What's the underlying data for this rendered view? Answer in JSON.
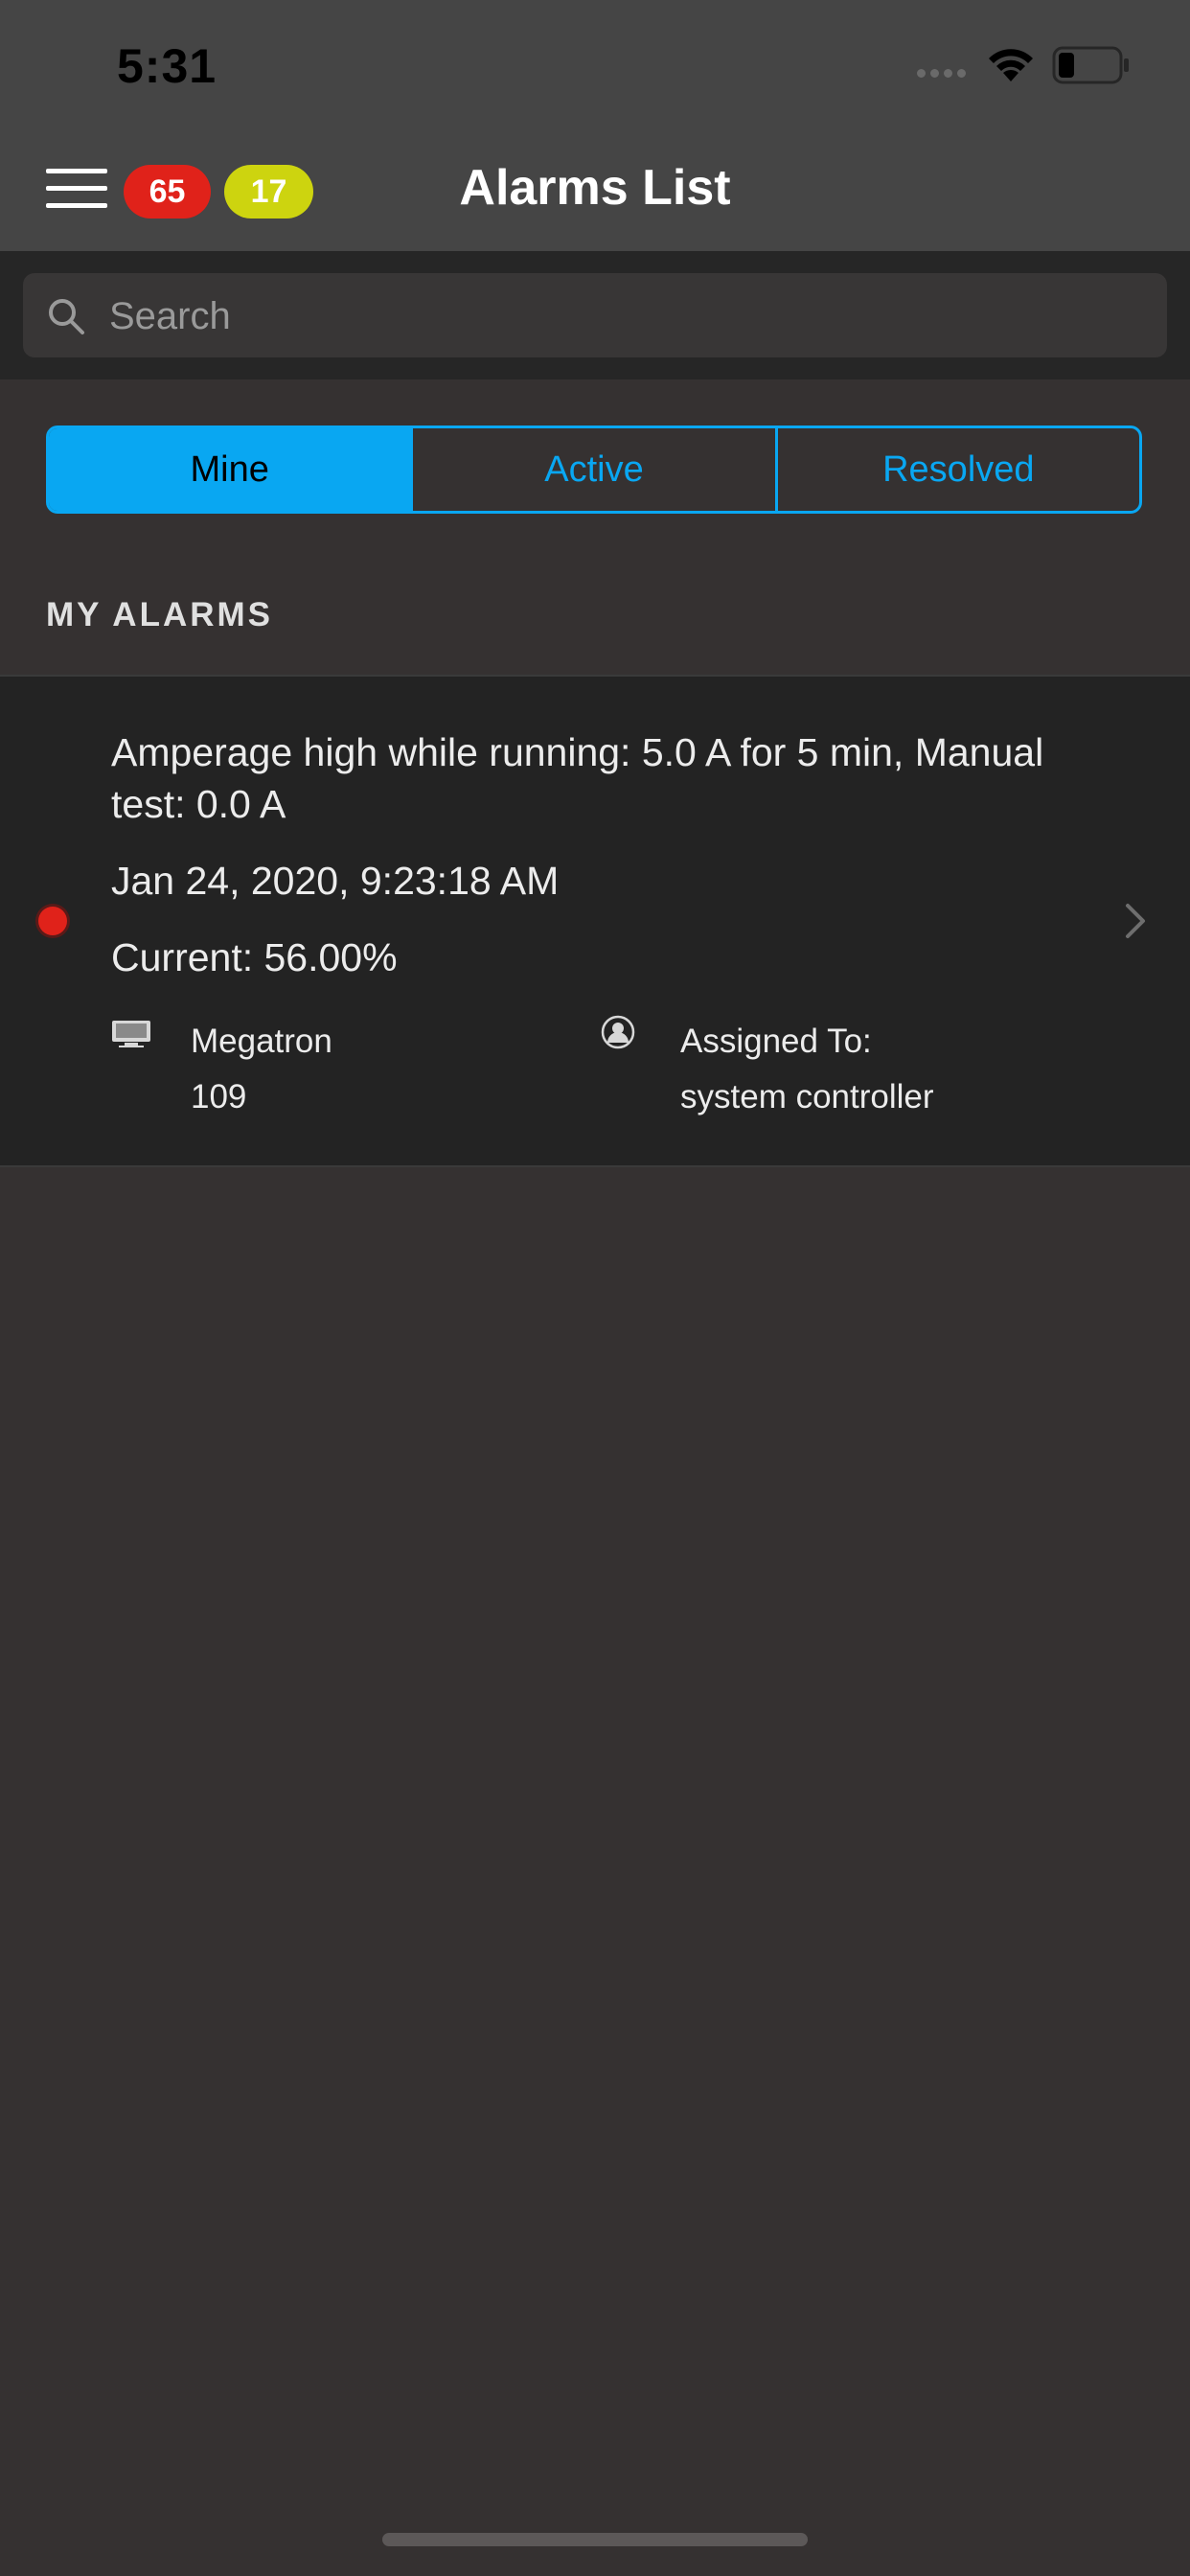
{
  "status_bar": {
    "time": "5:31"
  },
  "header": {
    "title": "Alarms List",
    "badges": {
      "critical_count": "65",
      "warning_count": "17"
    }
  },
  "search": {
    "placeholder": "Search",
    "value": ""
  },
  "tabs": [
    {
      "label": "Mine",
      "selected": true
    },
    {
      "label": "Active",
      "selected": false
    },
    {
      "label": "Resolved",
      "selected": false
    }
  ],
  "section": {
    "title": "MY ALARMS"
  },
  "alarms": [
    {
      "description": "Amperage high while running: 5.0 A for 5 min, Manual test: 0.0 A",
      "datetime": "Jan 24, 2020, 9:23:18 AM",
      "current": "Current: 56.00%",
      "device_name": "Megatron",
      "device_number": "109",
      "assigned_label": "Assigned To:",
      "assigned_to": "system controller",
      "status_color": "#e0221a"
    }
  ],
  "colors": {
    "accent": "#09a7f2",
    "critical": "#e0221a",
    "warning": "#cdd40f",
    "header_bg": "#454545",
    "background": "#353131"
  }
}
